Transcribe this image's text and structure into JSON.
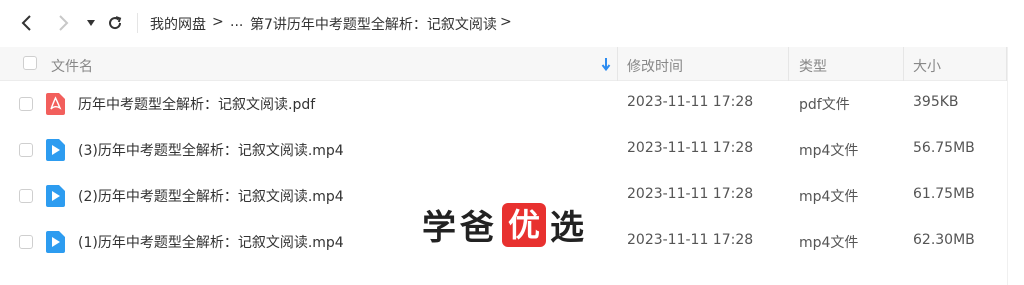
{
  "breadcrumb": {
    "items": [
      "我的网盘",
      "...",
      "第7讲历年中考题型全解析：记叙文阅读"
    ],
    "separator": ">"
  },
  "columns": {
    "name": "文件名",
    "time": "修改时间",
    "type": "类型",
    "size": "大小"
  },
  "files": [
    {
      "name": "历年中考题型全解析：记叙文阅读.pdf",
      "time": "2023-11-11 17:28",
      "type": "pdf文件",
      "size": "395KB",
      "icon": "pdf-icon"
    },
    {
      "name": "(3)历年中考题型全解析：记叙文阅读.mp4",
      "time": "2023-11-11 17:28",
      "type": "mp4文件",
      "size": "56.75MB",
      "icon": "video-file-icon"
    },
    {
      "name": "(2)历年中考题型全解析：记叙文阅读.mp4",
      "time": "2023-11-11 17:28",
      "type": "mp4文件",
      "size": "61.75MB",
      "icon": "video-file-icon"
    },
    {
      "name": "(1)历年中考题型全解析：记叙文阅读.mp4",
      "time": "2023-11-11 17:28",
      "type": "mp4文件",
      "size": "62.30MB",
      "icon": "video-file-icon"
    }
  ],
  "watermark": {
    "left": "学爸",
    "badge": "优",
    "right": "选"
  },
  "colors": {
    "pdf": "#f25f5c",
    "video": "#2d9cf0",
    "sort_arrow": "#2d8cf0",
    "badge": "#e8312f"
  }
}
